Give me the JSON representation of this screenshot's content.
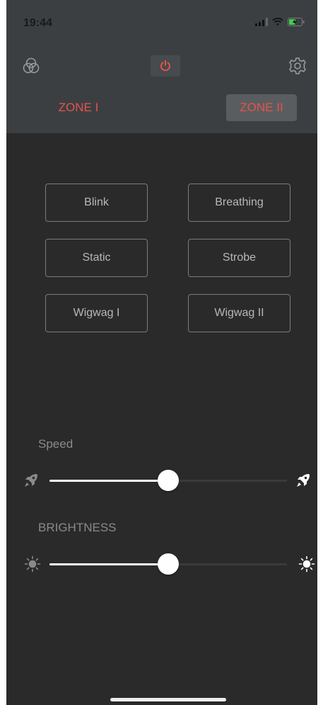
{
  "status_bar": {
    "time": "19:44"
  },
  "header": {
    "icons": {
      "left": "palette-icon",
      "center": "power-icon",
      "right": "gear-icon"
    },
    "zones": [
      {
        "label": "ZONE I",
        "selected": false
      },
      {
        "label": "ZONE II",
        "selected": true
      }
    ],
    "accent_color": "#e2554b"
  },
  "modes": [
    {
      "label": "Blink"
    },
    {
      "label": "Breathing"
    },
    {
      "label": "Static"
    },
    {
      "label": "Strobe"
    },
    {
      "label": "Wigwag I"
    },
    {
      "label": "Wigwag II"
    }
  ],
  "speed": {
    "label": "Speed",
    "value": 0.5,
    "icon_min": "rocket-icon",
    "icon_max": "rocket-icon"
  },
  "brightness": {
    "label": "BRIGHTNESS",
    "value": 0.5,
    "icon_min": "sun-icon",
    "icon_max": "sun-icon"
  }
}
